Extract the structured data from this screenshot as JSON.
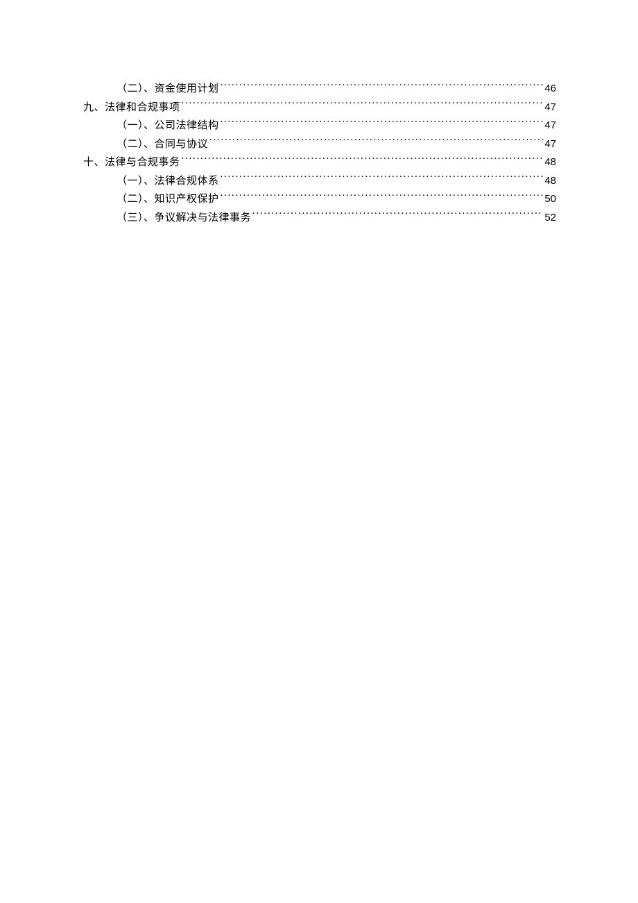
{
  "toc": [
    {
      "level": "sub",
      "label": "（二）、资金使用计划",
      "page": "46"
    },
    {
      "level": "main",
      "label": "九、法律和合规事项",
      "page": "47"
    },
    {
      "level": "sub",
      "label": "（一）、公司法律结构",
      "page": "47"
    },
    {
      "level": "sub",
      "label": "（二）、合同与协议",
      "page": "47"
    },
    {
      "level": "main",
      "label": "十、法律与合规事务",
      "page": "48"
    },
    {
      "level": "sub",
      "label": "（一）、法律合规体系",
      "page": "48"
    },
    {
      "level": "sub",
      "label": "（二）、知识产权保护",
      "page": "50"
    },
    {
      "level": "sub",
      "label": "（三）、争议解决与法律事务",
      "page": "52"
    }
  ]
}
